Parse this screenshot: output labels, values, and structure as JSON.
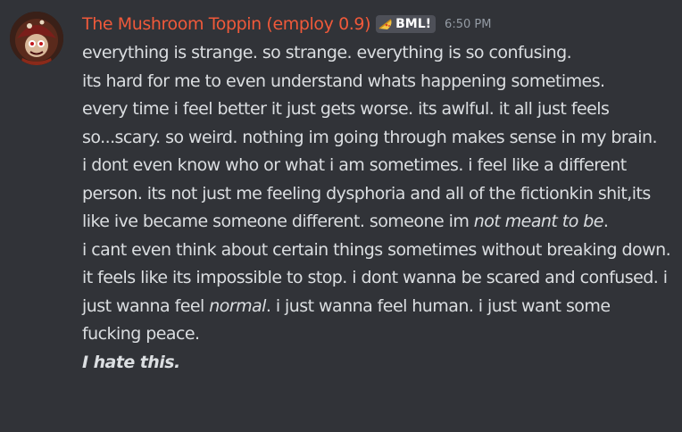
{
  "colors": {
    "background": "#313338",
    "username": "#f0593a",
    "tag_background": "#4e5058",
    "timestamp": "#949ba4",
    "text": "#dbdee1"
  },
  "message": {
    "author": "The Mushroom Toppin (employ 0.9)",
    "tag": {
      "icon": "pizza-slice-icon",
      "label": "BML!"
    },
    "timestamp": "6:50 PM",
    "paragraphs": [
      {
        "text": "everything is strange. so strange. everything is so confusing."
      },
      {
        "text": "its hard for me to even understand whats happening sometimes."
      },
      {
        "text": "every time i feel better it just gets worse. its awlful. it all just feels so...scary. so weird. nothing im going through makes sense in my brain."
      },
      {
        "before": "i dont even know who or what i am sometimes. i feel like a different person. its not just me feeling dysphoria and all of the fictionkin shit,its like ive became someone different. someone im ",
        "emphasis": "not meant to be",
        "after": "."
      },
      {
        "before": "i cant even think about certain things sometimes without breaking down. it feels like its impossible to stop. i dont wanna be scared and confused. i just wanna feel ",
        "emphasis": "normal",
        "after": ". i just wanna feel human. i just want some fucking peace."
      },
      {
        "strong_emphasis": "I hate this."
      }
    ]
  }
}
